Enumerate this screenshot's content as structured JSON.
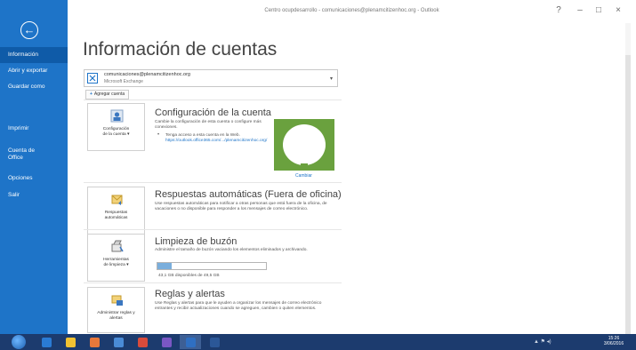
{
  "window": {
    "title": "Centro ocupdesarrollo - comunicaciones@plenamcitizenhoc.org - Outlook",
    "controls": {
      "help": "?",
      "minimize": "–",
      "restore": "□",
      "close": "×"
    }
  },
  "sidebar": {
    "back_icon": "←",
    "items": [
      {
        "label": "Información"
      },
      {
        "label": "Abrir y exportar"
      },
      {
        "label": "Guardar como"
      },
      {
        "label": "Imprimir"
      },
      {
        "label": "Cuenta de",
        "label2": "Office"
      },
      {
        "label": "Opciones"
      },
      {
        "label": "Salir"
      }
    ]
  },
  "main": {
    "heading": "Información de cuentas",
    "account": {
      "email": "comunicaciones@plenamcitizenhoc.org",
      "type": "Microsoft Exchange",
      "caret": "▾"
    },
    "add_account": {
      "plus": "+",
      "label": "Agregar cuenta"
    },
    "sections": {
      "config": {
        "tile_line1": "Configuración",
        "tile_line2": "de la cuenta ▾",
        "title": "Configuración de la cuenta",
        "desc": "Cambie la configuración de esta cuenta o configure más conexiones.",
        "bullet": "Tenga acceso a esta cuenta en la Web.",
        "link": "https://outlook.office365.com/.../plenamcitizenhoc.org/",
        "change": "Cambiar"
      },
      "auto": {
        "tile_line1": "Respuestas",
        "tile_line2": "automáticas",
        "title": "Respuestas automáticas (Fuera de oficina)",
        "desc": "Use respuestas automáticas para notificar a otras personas que está fuera de la oficina, de vacaciones o no disponible para responder a los mensajes de correo electrónico."
      },
      "cleanup": {
        "tile_line1": "Herramientas",
        "tile_line2": "de limpieza ▾",
        "title": "Limpieza de buzón",
        "desc": "Administre el tamaño de buzón vaciando los elementos eliminados y archivando.",
        "caption": "43,1 GB disponibles de 49,5 GB",
        "progress": 0.13
      },
      "rules": {
        "tile_line1": "Administrar reglas y",
        "tile_line2": "alertas",
        "title": "Reglas y alertas",
        "desc": "Use Reglas y alertas para que le ayuden a organizar los mensajes de correo electrónico entrantes y recibir actualizaciones cuando se agreguen, cambien o quiten elementos."
      }
    }
  },
  "taskbar": {
    "apps": [
      {
        "name": "ie-icon",
        "color": "#2a7bd4"
      },
      {
        "name": "folder-icon",
        "color": "#f1c232"
      },
      {
        "name": "media-icon",
        "color": "#e8783a"
      },
      {
        "name": "window-icon",
        "color": "#4a8bd6"
      },
      {
        "name": "chrome-icon",
        "color": "#d94b3b"
      },
      {
        "name": "people-icon",
        "color": "#7a57c4"
      },
      {
        "name": "outlook-icon",
        "color": "#2f6fc2"
      },
      {
        "name": "word-icon",
        "color": "#2b5797"
      }
    ],
    "tray": "▲ ⚑ ◂)",
    "time": "15:26",
    "date": "3/06/2016"
  }
}
